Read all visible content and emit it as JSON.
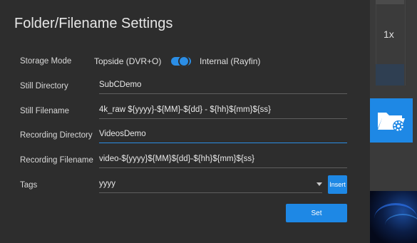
{
  "dialog": {
    "title": "Folder/Filename Settings"
  },
  "storage_mode": {
    "label": "Storage Mode",
    "option_left": "Topside (DVR+O)",
    "option_right": "Internal (Rayfin)",
    "selected": "Internal (Rayfin)"
  },
  "still_directory": {
    "label": "Still Directory",
    "value": "SubCDemo"
  },
  "still_filename": {
    "label": "Still Filename",
    "value": "4k_raw ${yyyy}-${MM}-${dd} - ${hh}${mm}${ss}"
  },
  "recording_directory": {
    "label": "Recording Directory",
    "value": "VideosDemo"
  },
  "recording_filename": {
    "label": "Recording Filename",
    "value": "video-${yyyy}${MM}${dd}-${hh}${mm}${ss}"
  },
  "tags": {
    "label": "Tags",
    "selected": "yyyy",
    "insert_label": "Insert"
  },
  "set_label": "Set",
  "side_panel": {
    "speed_label": "1x",
    "folder_settings_icon": "folder-gear-icon"
  },
  "colors": {
    "accent": "#1e88e5",
    "background": "#2d2d2d"
  }
}
